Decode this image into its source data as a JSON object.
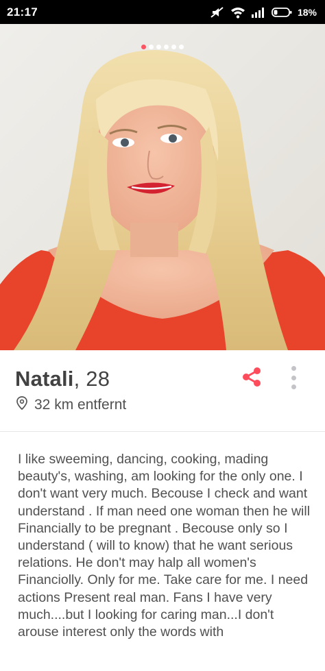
{
  "status_bar": {
    "time": "21:17",
    "battery_percent": "18%",
    "icons": [
      "mute-icon",
      "wifi-icon",
      "signal-icon",
      "battery-icon"
    ]
  },
  "photo": {
    "total_photos": 6,
    "current_index": 0,
    "accent_color": "#fd4c5c"
  },
  "profile": {
    "name": "Natali",
    "age": ", 28",
    "distance": "32 km entfernt",
    "bio": "I like sweeming, dancing, cooking, mading beauty's, washing,  am looking for the only one. I don't want very much. Becouse I check and want understand . If man need one woman then he will Financially to be pregnant . Becouse only so I understand ( will to know) that he want serious relations. He don't may halp all women's Financiolly. Only for me. Take care for me. I need actions Present real man. Fans I have very much....but I looking for caring man...I don't arouse interest only the words with"
  },
  "actions": {
    "share_icon": "share-icon",
    "more_icon": "more-vertical-icon"
  }
}
